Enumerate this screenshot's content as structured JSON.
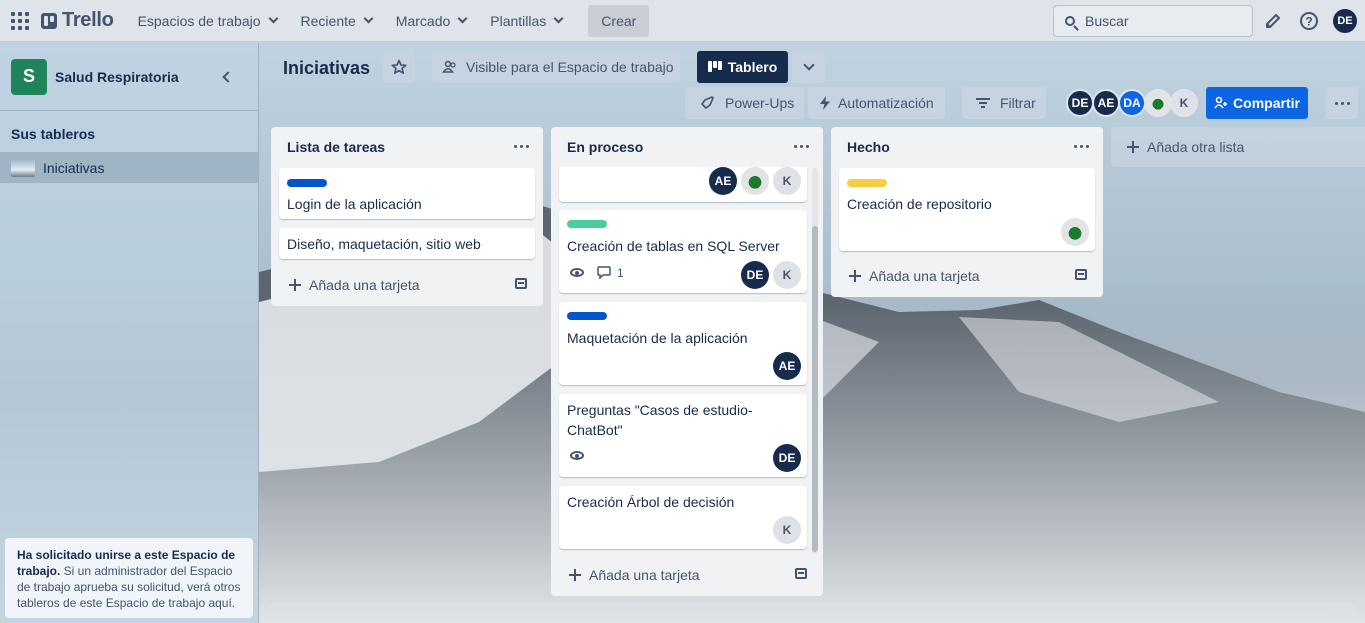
{
  "topbar": {
    "brand": "Trello",
    "nav": [
      "Espacios de trabajo",
      "Reciente",
      "Marcado",
      "Plantillas"
    ],
    "create_label": "Crear",
    "search_placeholder": "Buscar",
    "user_initials": "DE"
  },
  "sidebar": {
    "workspace_initial": "S",
    "workspace_name": "Salud Respiratoria",
    "boards_heading": "Sus tableros",
    "boards": [
      "Iniciativas"
    ],
    "notice_bold": "Ha solicitado unirse a este Espacio de trabajo.",
    "notice_text": " Si un administrador del Espacio de trabajo aprueba su solicitud, verá otros tableros de este Espacio de trabajo aquí."
  },
  "board": {
    "title": "Iniciativas",
    "visibility": "Visible para el Espacio de trabajo",
    "view": "Tablero",
    "powerups": "Power-Ups",
    "automation": "Automatización",
    "filter": "Filtrar",
    "members": [
      "DE",
      "AE",
      "DA",
      "K"
    ],
    "share": "Compartir",
    "add_list": "Añada otra lista"
  },
  "lists": [
    {
      "title": "Lista de tareas",
      "add_card": "Añada una tarjeta",
      "cards": [
        {
          "title": "Login de la aplicación",
          "label_color": "#0055cc"
        },
        {
          "title": "Diseño, maquetación, sitio web"
        }
      ]
    },
    {
      "title": "En proceso",
      "add_card": "Añada una tarjeta",
      "cards": [
        {
          "members": [
            "AE",
            "K"
          ]
        },
        {
          "title": "Creación de tablas en SQL Server",
          "label_color": "#4bce97",
          "comments": "1",
          "members": [
            "DE",
            "K"
          ]
        },
        {
          "title": "Maquetación de la aplicación",
          "label_color": "#0055cc",
          "members": [
            "AE"
          ]
        },
        {
          "title": "Preguntas \"Casos de estudio-ChatBot\"",
          "members": [
            "DE"
          ]
        },
        {
          "title": "Creación Árbol de decisión",
          "members": [
            "K"
          ]
        }
      ]
    },
    {
      "title": "Hecho",
      "add_card": "Añada una tarjeta",
      "cards": [
        {
          "title": "Creación de repositorio",
          "label_color": "#f5cd47"
        }
      ]
    }
  ]
}
